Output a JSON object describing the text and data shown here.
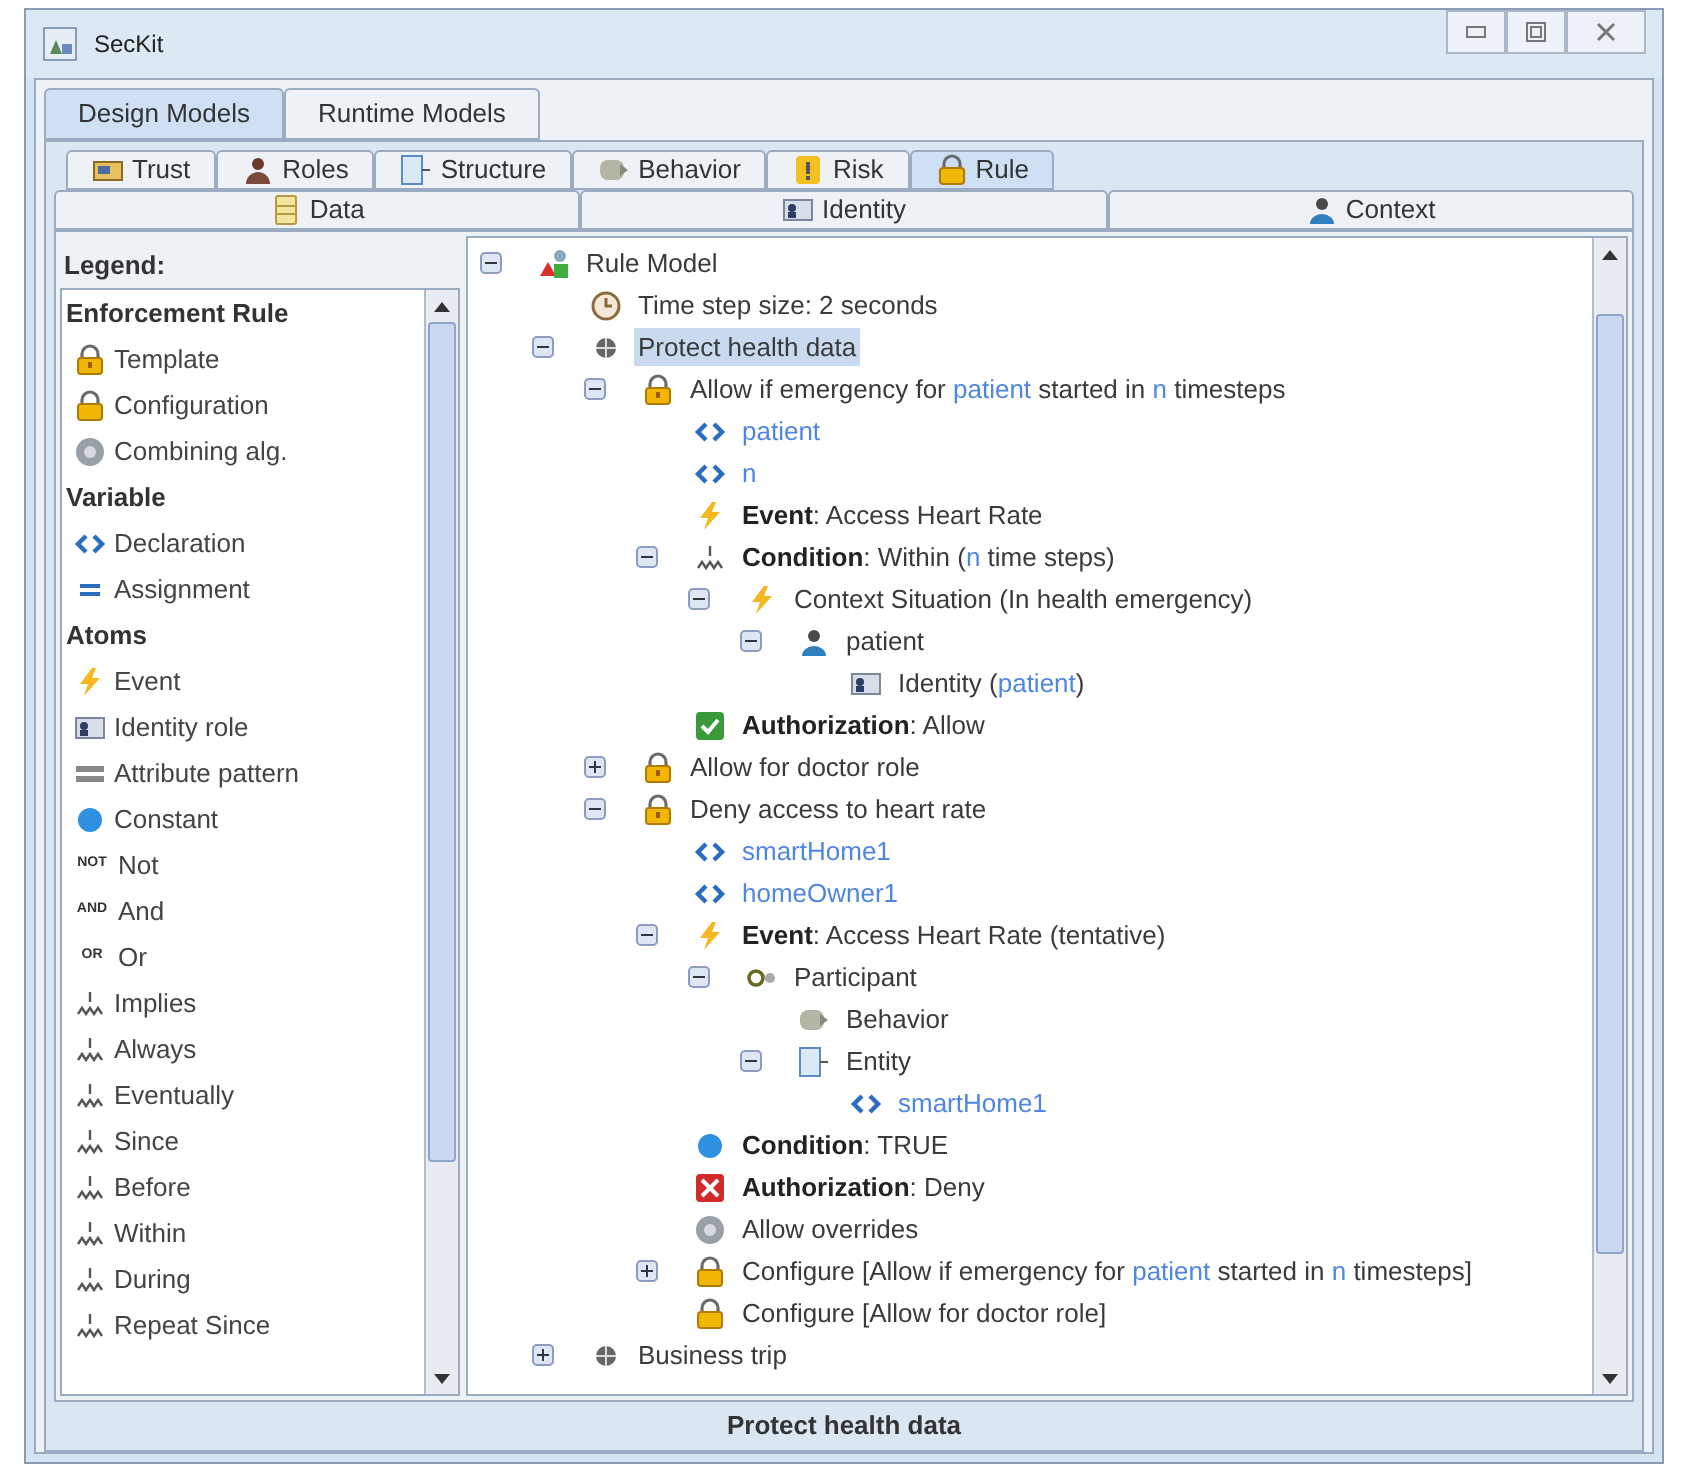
{
  "window": {
    "title": "SecKit"
  },
  "main_tabs": [
    {
      "label": "Design Models",
      "selected": true
    },
    {
      "label": "Runtime Models",
      "selected": false
    }
  ],
  "model_tabs": [
    {
      "label": "Trust",
      "kind": "trust",
      "selected": false
    },
    {
      "label": "Roles",
      "kind": "roles",
      "selected": false
    },
    {
      "label": "Structure",
      "kind": "structure",
      "selected": false
    },
    {
      "label": "Behavior",
      "kind": "behavior",
      "selected": false
    },
    {
      "label": "Risk",
      "kind": "risk",
      "selected": false
    },
    {
      "label": "Rule",
      "kind": "lock",
      "selected": true
    }
  ],
  "model_tabs_row2": [
    {
      "label": "Data",
      "kind": "data",
      "selected": false
    },
    {
      "label": "Identity",
      "kind": "identity",
      "selected": false
    },
    {
      "label": "Context",
      "kind": "person",
      "selected": false
    }
  ],
  "legend": {
    "title": "Legend:",
    "sections": [
      {
        "title": "Enforcement Rule",
        "items": [
          {
            "label": "Template",
            "kind": "template"
          },
          {
            "label": "Configuration",
            "kind": "configuration"
          },
          {
            "label": "Combining alg.",
            "kind": "combining"
          }
        ]
      },
      {
        "title": "Variable",
        "items": [
          {
            "label": "Declaration",
            "kind": "declaration"
          },
          {
            "label": "Assignment",
            "kind": "assignment"
          }
        ]
      },
      {
        "title": "Atoms",
        "items": [
          {
            "label": "Event",
            "kind": "event"
          },
          {
            "label": "Identity role",
            "kind": "identity"
          },
          {
            "label": "Attribute pattern",
            "kind": "attribute"
          },
          {
            "label": "Constant",
            "kind": "constant"
          },
          {
            "label": "Not",
            "kind": "badge",
            "badge": "NOT"
          },
          {
            "label": "And",
            "kind": "badge",
            "badge": "AND"
          },
          {
            "label": "Or",
            "kind": "badge",
            "badge": "OR"
          },
          {
            "label": "Implies",
            "kind": "implies"
          },
          {
            "label": "Always",
            "kind": "temporal"
          },
          {
            "label": "Eventually",
            "kind": "temporal"
          },
          {
            "label": "Since",
            "kind": "temporal"
          },
          {
            "label": "Before",
            "kind": "temporal"
          },
          {
            "label": "Within",
            "kind": "temporal"
          },
          {
            "label": "During",
            "kind": "temporal"
          },
          {
            "label": "Repeat Since",
            "kind": "temporal"
          }
        ]
      }
    ]
  },
  "tree": [
    {
      "kind": "model",
      "expanded": true,
      "selected": false,
      "parts": [
        {
          "text": "Rule Model",
          "kind": "plain"
        }
      ],
      "children": [
        {
          "kind": "clock",
          "selected": false,
          "parts": [
            {
              "text": "Time step size: 2 seconds",
              "kind": "plain"
            }
          ]
        },
        {
          "kind": "policy",
          "expanded": true,
          "selected": true,
          "parts": [
            {
              "text": "Protect health data",
              "kind": "plain"
            }
          ],
          "children": [
            {
              "kind": "template",
              "expanded": true,
              "selected": false,
              "parts": [
                {
                  "text": "Allow if emergency for ",
                  "kind": "plain"
                },
                {
                  "text": "patient",
                  "kind": "var"
                },
                {
                  "text": " started in ",
                  "kind": "plain"
                },
                {
                  "text": "n",
                  "kind": "var"
                },
                {
                  "text": " timesteps",
                  "kind": "plain"
                }
              ],
              "children": [
                {
                  "kind": "declaration",
                  "selected": false,
                  "parts": [
                    {
                      "text": "patient",
                      "kind": "var"
                    }
                  ]
                },
                {
                  "kind": "declaration",
                  "selected": false,
                  "parts": [
                    {
                      "text": "n",
                      "kind": "var"
                    }
                  ]
                },
                {
                  "kind": "event",
                  "selected": false,
                  "parts": [
                    {
                      "text": "Event",
                      "kind": "bold"
                    },
                    {
                      "text": ": Access Heart Rate",
                      "kind": "plain"
                    }
                  ]
                },
                {
                  "kind": "temporal",
                  "expanded": true,
                  "selected": false,
                  "parts": [
                    {
                      "text": "Condition",
                      "kind": "bold"
                    },
                    {
                      "text": ": Within (",
                      "kind": "plain"
                    },
                    {
                      "text": "n",
                      "kind": "var"
                    },
                    {
                      "text": " time steps)",
                      "kind": "plain"
                    }
                  ],
                  "children": [
                    {
                      "kind": "event",
                      "expanded": true,
                      "selected": false,
                      "parts": [
                        {
                          "text": "Context Situation (In health emergency)",
                          "kind": "plain"
                        }
                      ],
                      "children": [
                        {
                          "kind": "person",
                          "expanded": true,
                          "selected": false,
                          "parts": [
                            {
                              "text": "patient",
                              "kind": "plain"
                            }
                          ],
                          "children": [
                            {
                              "kind": "identity",
                              "selected": false,
                              "parts": [
                                {
                                  "text": "Identity (",
                                  "kind": "plain"
                                },
                                {
                                  "text": "patient",
                                  "kind": "var"
                                },
                                {
                                  "text": ")",
                                  "kind": "plain"
                                }
                              ]
                            }
                          ]
                        }
                      ]
                    }
                  ]
                },
                {
                  "kind": "allow",
                  "selected": false,
                  "parts": [
                    {
                      "text": "Authorization",
                      "kind": "bold"
                    },
                    {
                      "text": ": Allow",
                      "kind": "plain"
                    }
                  ]
                }
              ]
            },
            {
              "kind": "template",
              "expanded": false,
              "selected": false,
              "parts": [
                {
                  "text": "Allow for doctor role",
                  "kind": "plain"
                }
              ]
            },
            {
              "kind": "template",
              "expanded": true,
              "selected": false,
              "parts": [
                {
                  "text": "Deny access to heart rate",
                  "kind": "plain"
                }
              ],
              "children": [
                {
                  "kind": "declaration",
                  "selected": false,
                  "parts": [
                    {
                      "text": "smartHome1",
                      "kind": "var"
                    }
                  ]
                },
                {
                  "kind": "declaration",
                  "selected": false,
                  "parts": [
                    {
                      "text": "homeOwner1",
                      "kind": "var"
                    }
                  ]
                },
                {
                  "kind": "event",
                  "expanded": true,
                  "selected": false,
                  "parts": [
                    {
                      "text": "Event",
                      "kind": "bold"
                    },
                    {
                      "text": ": Access Heart Rate (tentative)",
                      "kind": "plain"
                    }
                  ],
                  "children": [
                    {
                      "kind": "participant",
                      "expanded": true,
                      "selected": false,
                      "parts": [
                        {
                          "text": "Participant",
                          "kind": "plain"
                        }
                      ],
                      "children": [
                        {
                          "kind": "behavior",
                          "selected": false,
                          "parts": [
                            {
                              "text": "Behavior",
                              "kind": "plain"
                            }
                          ]
                        },
                        {
                          "kind": "structure",
                          "expanded": true,
                          "selected": false,
                          "parts": [
                            {
                              "text": "Entity",
                              "kind": "plain"
                            }
                          ],
                          "children": [
                            {
                              "kind": "declaration",
                              "selected": false,
                              "parts": [
                                {
                                  "text": "smartHome1",
                                  "kind": "var"
                                }
                              ]
                            }
                          ]
                        }
                      ]
                    }
                  ]
                },
                {
                  "kind": "constant",
                  "selected": false,
                  "parts": [
                    {
                      "text": "Condition",
                      "kind": "bold"
                    },
                    {
                      "text": ": TRUE",
                      "kind": "plain"
                    }
                  ]
                },
                {
                  "kind": "deny",
                  "selected": false,
                  "parts": [
                    {
                      "text": "Authorization",
                      "kind": "bold"
                    },
                    {
                      "text": ": Deny",
                      "kind": "plain"
                    }
                  ]
                },
                {
                  "kind": "combining",
                  "selected": false,
                  "parts": [
                    {
                      "text": "Allow overrides",
                      "kind": "plain"
                    }
                  ]
                },
                {
                  "kind": "configuration",
                  "expanded": false,
                  "selected": false,
                  "parts": [
                    {
                      "text": "Configure [Allow if emergency for ",
                      "kind": "plain"
                    },
                    {
                      "text": "patient",
                      "kind": "var"
                    },
                    {
                      "text": " started in ",
                      "kind": "plain"
                    },
                    {
                      "text": "n",
                      "kind": "var"
                    },
                    {
                      "text": " timesteps]",
                      "kind": "plain"
                    }
                  ]
                },
                {
                  "kind": "configuration",
                  "selected": false,
                  "parts": [
                    {
                      "text": "Configure [Allow for doctor role]",
                      "kind": "plain"
                    }
                  ]
                }
              ]
            }
          ]
        },
        {
          "kind": "policy",
          "expanded": false,
          "selected": false,
          "parts": [
            {
              "text": "Business trip",
              "kind": "plain"
            }
          ]
        }
      ]
    }
  ],
  "status_bar": "Protect health data"
}
